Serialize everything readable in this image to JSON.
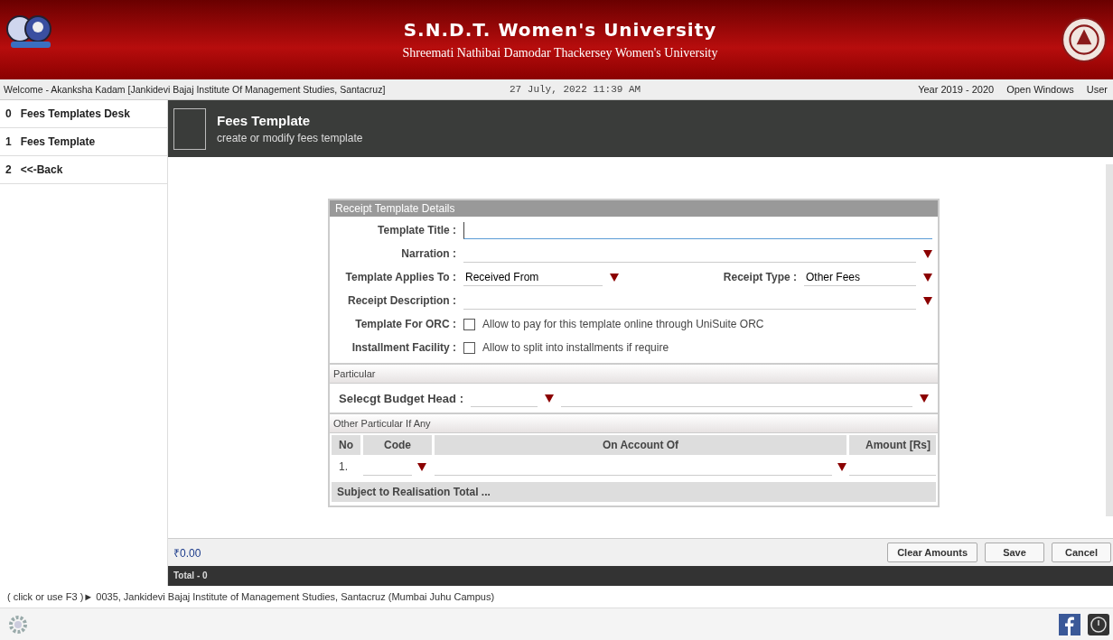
{
  "header": {
    "title": "S.N.D.T. Women's University",
    "subtitle": "Shreemati Nathibai Damodar Thackersey Women's University"
  },
  "info_bar": {
    "welcome": "Welcome - Akanksha Kadam [Jankidevi Bajaj Institute Of Management Studies, Santacruz]",
    "datetime": "27 July, 2022 11:39 AM",
    "links": [
      "Year 2019 - 2020",
      "Open Windows",
      "User"
    ]
  },
  "sidebar": {
    "items": [
      {
        "number": "0",
        "label": "Fees Templates Desk"
      },
      {
        "number": "1",
        "label": "Fees Template"
      },
      {
        "number": "2",
        "label": "<<-Back"
      }
    ]
  },
  "page_header": {
    "title": "Fees Template",
    "subtitle": "create or modify fees template"
  },
  "form": {
    "title": "Receipt Template Details",
    "template_title": {
      "label": "Template Title :"
    },
    "narration": {
      "label": "Narration :"
    },
    "applies_to": {
      "label": "Template Applies To :",
      "value": "Received From"
    },
    "receipt_type": {
      "label": "Receipt Type :",
      "value": "Other Fees"
    },
    "receipt_description": {
      "label": "Receipt Description :"
    },
    "orc": {
      "label": "Template For ORC :",
      "checkbox_label": "Allow to pay for this template online through UniSuite ORC",
      "checked": false
    },
    "installment": {
      "label": "Installment Facility :",
      "checkbox_label": "Allow to split into installments if require",
      "checked": false
    },
    "particular": {
      "title": "Particular",
      "budget_label": "Selecgt Budget Head :"
    },
    "other": {
      "title": "Other Particular If Any",
      "columns": [
        "No",
        "Code",
        "On Account Of",
        "Amount [Rs]"
      ],
      "rows": [
        {
          "no": "1."
        }
      ]
    },
    "total_label": "Subject to Realisation Total ..."
  },
  "bottom_bar": {
    "amount": "₹0.00",
    "buttons": [
      "Clear Amounts",
      "Save",
      "Cancel"
    ],
    "total": "Total - 0"
  },
  "status_bar": {
    "text": "( click or use F3 )► 0035, Jankidevi Bajaj Institute of Management Studies, Santacruz (Mumbai Juhu Campus)"
  }
}
